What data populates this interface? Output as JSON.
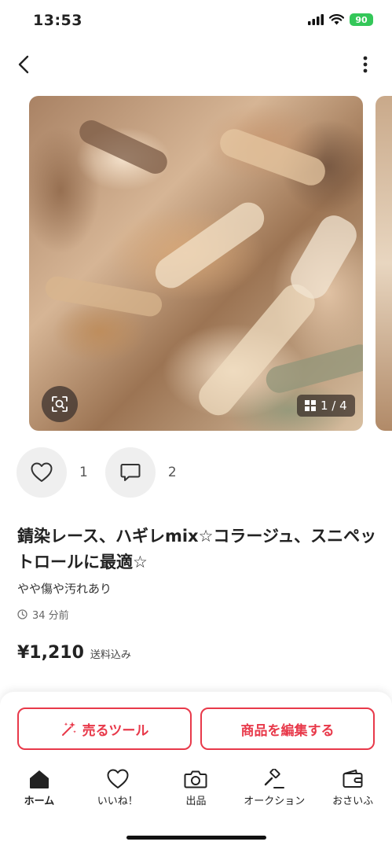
{
  "status_bar": {
    "time": "13:53",
    "battery": "90"
  },
  "carousel": {
    "counter": "1 / 4"
  },
  "actions": {
    "like_count": "1",
    "comment_count": "2"
  },
  "item": {
    "title": "錆染レース、ハギレmix☆コラージュ、スニペットロールに最適☆",
    "condition": "やや傷や汚れあり",
    "posted_ago": "34 分前",
    "price": "¥1,210",
    "shipping": "送料込み"
  },
  "bottom": {
    "sell_tools_label": "売るツール",
    "edit_label": "商品を編集する"
  },
  "tabs": [
    {
      "label": "ホーム",
      "icon": "home-icon"
    },
    {
      "label": "いいね！",
      "icon": "heart-icon"
    },
    {
      "label": "出品",
      "icon": "camera-icon"
    },
    {
      "label": "オークション",
      "icon": "gavel-icon"
    },
    {
      "label": "おさいふ",
      "icon": "wallet-icon"
    }
  ],
  "colors": {
    "accent": "#e8394a",
    "battery": "#34c759"
  }
}
